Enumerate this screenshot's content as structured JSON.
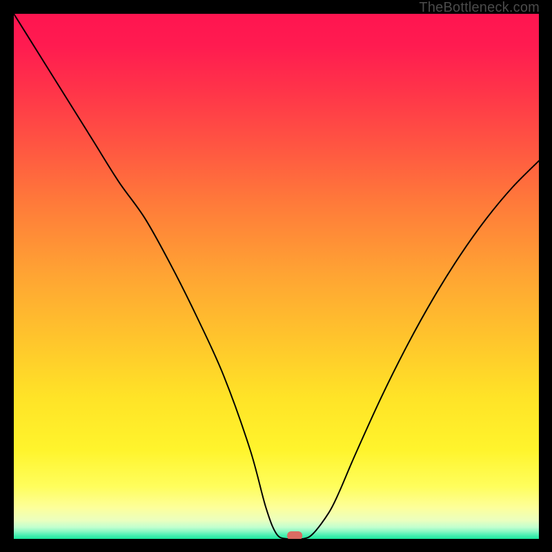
{
  "watermark": "TheBottleneck.com",
  "colors": {
    "curve": "#000000",
    "marker": "#d96b63",
    "frame": "#000000"
  },
  "chart_data": {
    "type": "line",
    "title": "",
    "xlabel": "",
    "ylabel": "",
    "xlim": [
      0,
      100
    ],
    "ylim": [
      0,
      100
    ],
    "grid": false,
    "legend": false,
    "series": [
      {
        "name": "bottleneck-curve",
        "x": [
          0,
          5,
          10,
          15,
          20,
          25,
          30,
          35,
          40,
          45,
          48,
          50,
          52,
          55,
          57,
          60,
          62,
          65,
          70,
          75,
          80,
          85,
          90,
          95,
          100
        ],
        "values": [
          100,
          92,
          84,
          76,
          68,
          61,
          52,
          42,
          31,
          17,
          6,
          1,
          0,
          0,
          1,
          5,
          9,
          16,
          27,
          37,
          46,
          54,
          61,
          67,
          72
        ]
      }
    ],
    "marker": {
      "x": 53.5,
      "y": 0,
      "shape": "rounded-rect"
    },
    "background_gradient": {
      "direction": "vertical",
      "stops": [
        {
          "pos": 0.0,
          "color": "#ff1550"
        },
        {
          "pos": 0.5,
          "color": "#ffa533"
        },
        {
          "pos": 0.9,
          "color": "#fffe5c"
        },
        {
          "pos": 1.0,
          "color": "#1be79d"
        }
      ]
    }
  }
}
